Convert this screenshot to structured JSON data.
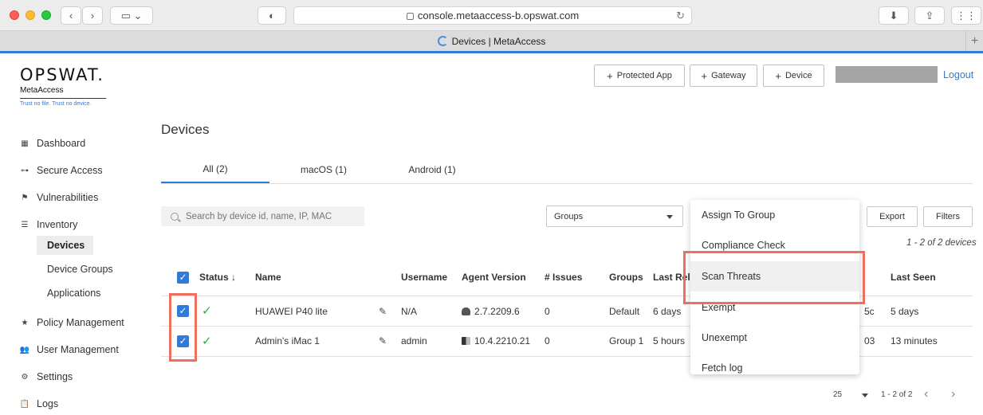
{
  "browser": {
    "url": "console.metaaccess-b.opswat.com",
    "tab_title": "Devices | MetaAccess"
  },
  "brand": {
    "name": "OPSWAT.",
    "product": "MetaAccess",
    "tagline": "Trust no file. Trust no device."
  },
  "sidebar": {
    "items": [
      {
        "label": "Dashboard",
        "icon": "grid-icon"
      },
      {
        "label": "Secure Access",
        "icon": "key-icon"
      },
      {
        "label": "Vulnerabilities",
        "icon": "flag-icon"
      },
      {
        "label": "Inventory",
        "icon": "list-icon"
      },
      {
        "label": "Policy Management",
        "icon": "star-icon"
      },
      {
        "label": "User Management",
        "icon": "users-icon"
      },
      {
        "label": "Settings",
        "icon": "gear-icon"
      },
      {
        "label": "Logs",
        "icon": "clipboard-icon"
      }
    ],
    "inventory_sub": [
      "Devices",
      "Device Groups",
      "Applications"
    ]
  },
  "header": {
    "buttons": [
      "Protected App",
      "Gateway",
      "Device"
    ],
    "logout": "Logout"
  },
  "page": {
    "title": "Devices",
    "tabs": [
      "All (2)",
      "macOS (1)",
      "Android (1)"
    ],
    "search_placeholder": "Search by device id, name, IP, MAC",
    "groups_label": "Groups",
    "export_label": "Export",
    "filters_label": "Filters",
    "count_info": "1 - 2 of 2 devices"
  },
  "table": {
    "headers": [
      "Status",
      "Name",
      "Username",
      "Agent Version",
      "# Issues",
      "Groups",
      "Last Rel",
      "Last Seen"
    ],
    "rows": [
      {
        "name": "HUAWEI P40 lite",
        "username": "N/A",
        "agent": "2.7.2209.6",
        "issues": "0",
        "groups": "Default",
        "last_reb": "6 days",
        "mid": "5c",
        "last_seen": "5 days",
        "os": "android"
      },
      {
        "name": "Admin's iMac 1",
        "username": "admin",
        "agent": "10.4.2210.21",
        "issues": "0",
        "groups": "Group 1",
        "last_reb": "5 hours",
        "mid": "03",
        "last_seen": "13 minutes",
        "os": "mac"
      }
    ]
  },
  "menu": {
    "items": [
      "Assign To Group",
      "Compliance Check",
      "Scan Threats",
      "Exempt",
      "Unexempt",
      "Fetch log"
    ]
  },
  "pagination": {
    "page_size": "25",
    "range": "1 - 2 of 2"
  },
  "colors": {
    "accent": "#2f7bd8",
    "highlight": "#ef6f5e",
    "ok": "#2fa84f"
  }
}
